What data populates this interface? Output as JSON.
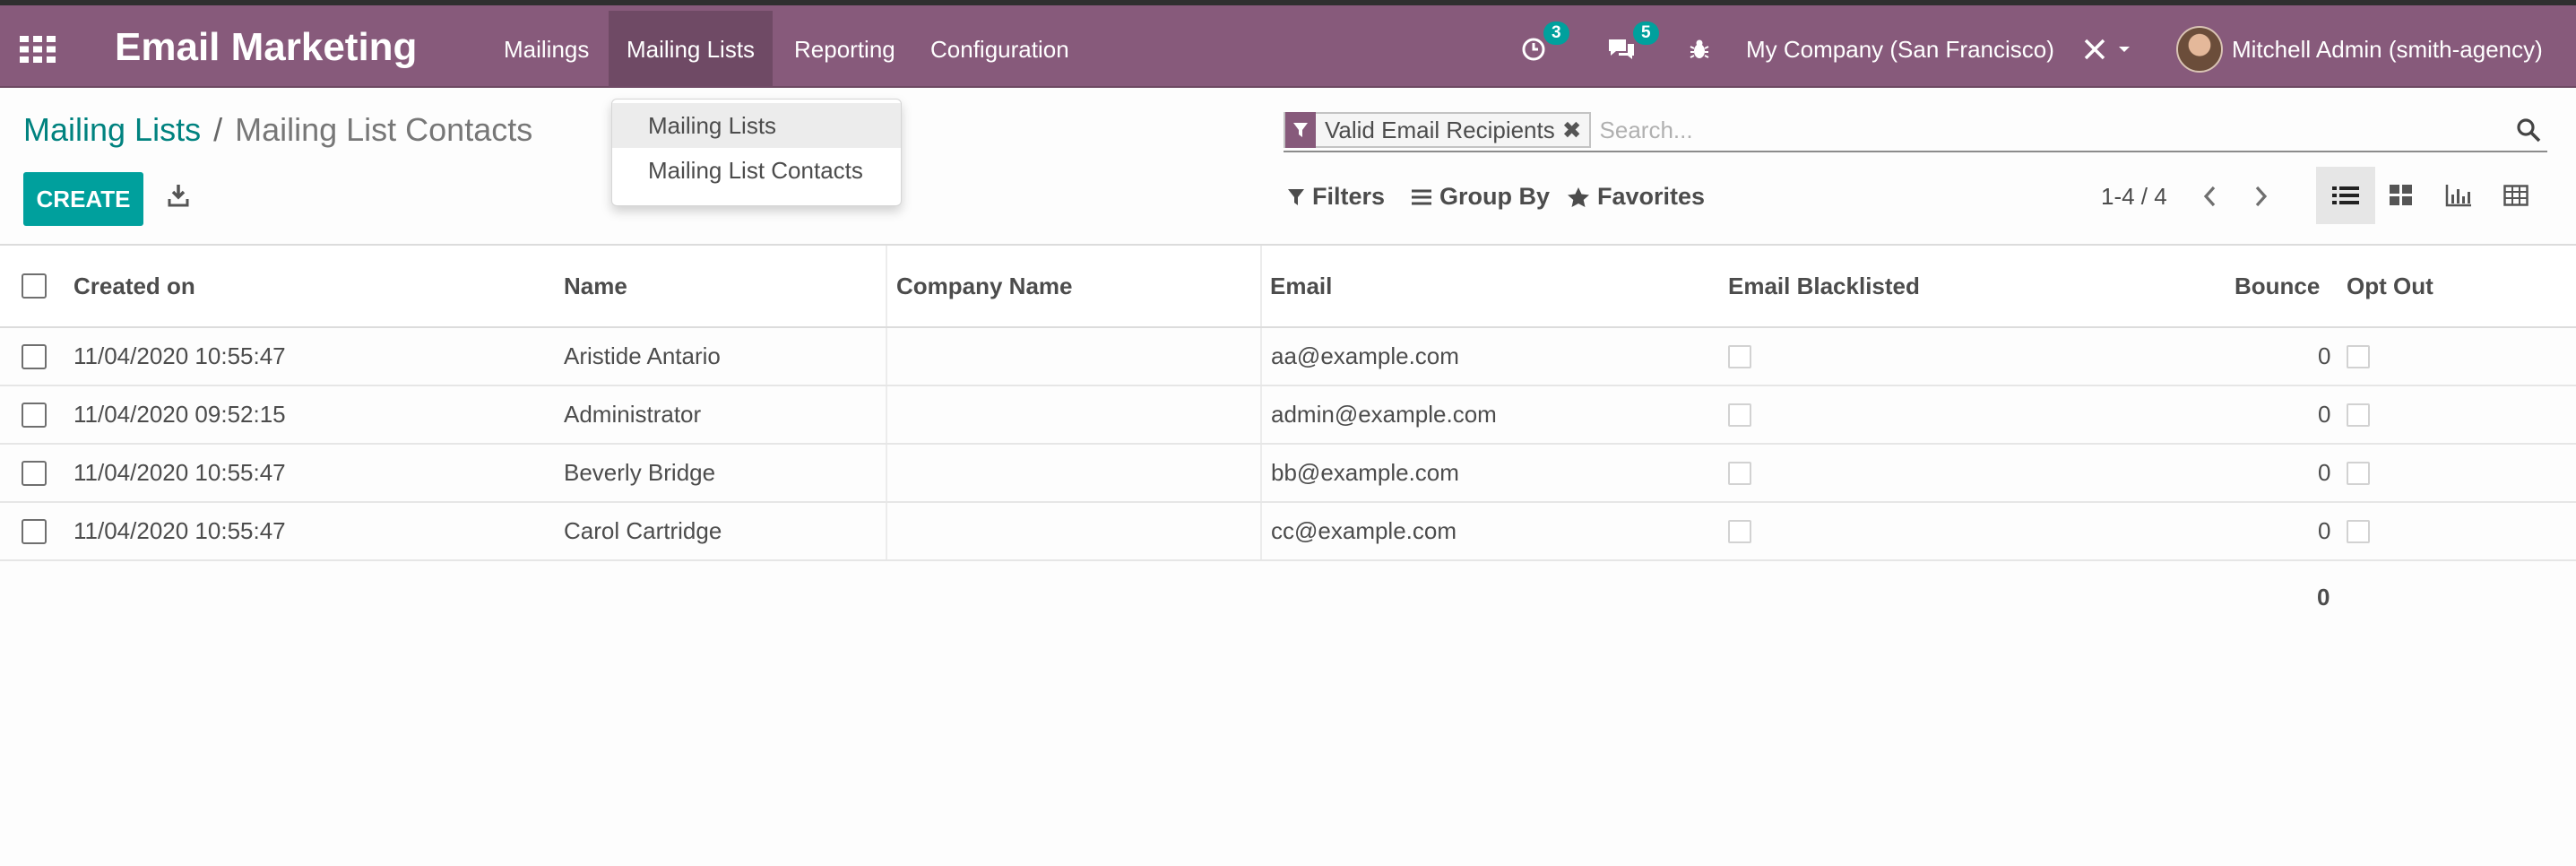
{
  "app": {
    "title": "Email Marketing",
    "menu": [
      {
        "label": "Mailings"
      },
      {
        "label": "Mailing Lists"
      },
      {
        "label": "Reporting"
      },
      {
        "label": "Configuration"
      }
    ],
    "activities_count": "3",
    "messages_count": "5",
    "company": "My Company (San Francisco)",
    "user": "Mitchell Admin (smith-agency)"
  },
  "dropdown": {
    "items": [
      {
        "label": "Mailing Lists"
      },
      {
        "label": "Mailing List Contacts"
      }
    ]
  },
  "breadcrumb": {
    "parent": "Mailing Lists",
    "separator": "/",
    "current": "Mailing List Contacts"
  },
  "toolbar": {
    "create_label": "CREATE"
  },
  "search": {
    "facet_label": "Valid Email Recipients",
    "placeholder": "Search...",
    "filters_label": "Filters",
    "group_by_label": "Group By",
    "favorites_label": "Favorites"
  },
  "pager": {
    "text": "1-4 / 4"
  },
  "table": {
    "columns": {
      "created_on": "Created on",
      "name": "Name",
      "company_name": "Company Name",
      "email": "Email",
      "email_blacklisted": "Email Blacklisted",
      "bounce": "Bounce",
      "opt_out": "Opt Out"
    },
    "rows": [
      {
        "created_on": "11/04/2020 10:55:47",
        "name": "Aristide Antario",
        "company_name": "",
        "email": "aa@example.com",
        "bounce": "0"
      },
      {
        "created_on": "11/04/2020 09:52:15",
        "name": "Administrator",
        "company_name": "",
        "email": "admin@example.com",
        "bounce": "0"
      },
      {
        "created_on": "11/04/2020 10:55:47",
        "name": "Beverly Bridge",
        "company_name": "",
        "email": "bb@example.com",
        "bounce": "0"
      },
      {
        "created_on": "11/04/2020 10:55:47",
        "name": "Carol Cartridge",
        "company_name": "",
        "email": "cc@example.com",
        "bounce": "0"
      }
    ],
    "bounce_total": "0"
  },
  "colors": {
    "navbar": "#875a7b",
    "primary": "#00a09d",
    "link": "#00827f"
  }
}
